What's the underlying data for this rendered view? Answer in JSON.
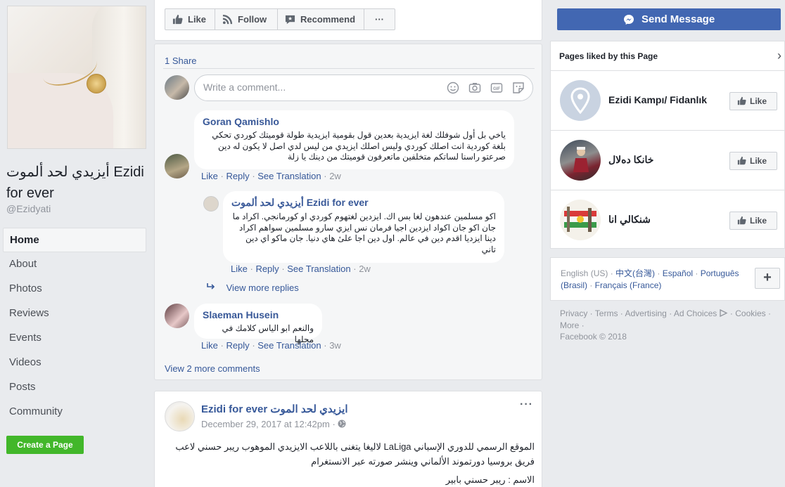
{
  "sidebar": {
    "page_name": "أيزيدي لحد ألموت Ezidi for ever",
    "handle": "@Ezidyati",
    "nav": [
      {
        "label": "Home",
        "active": true
      },
      {
        "label": "About"
      },
      {
        "label": "Photos"
      },
      {
        "label": "Reviews"
      },
      {
        "label": "Events"
      },
      {
        "label": "Videos"
      },
      {
        "label": "Posts"
      },
      {
        "label": "Community"
      }
    ],
    "create_page_label": "Create a Page"
  },
  "actions": {
    "like": "Like",
    "follow": "Follow",
    "recommend": "Recommend",
    "more": "···"
  },
  "post1": {
    "shares": "1 Share",
    "comment_placeholder": "Write a comment...",
    "comments": [
      {
        "author": "Goran Qamishlo",
        "text": "ياخي بل أول شوفلك لغة ايزيدية بعدين قول بقومية ايزيدية طولة قوميتك كوردي تحكي بلغة كوردية انت اصلك كوردي وليس اصلك ايزيدي من ليس لدي اصل لا يكون له دين صرعتو راسنا لساتكم متخلفين ماتعرفون قوميتك من دينك يا زلة",
        "like": "Like",
        "reply": "Reply",
        "translate": "See Translation",
        "time": "2w"
      },
      {
        "author": "أيزيدي لحد ألموت Ezidi for ever",
        "text": "اكو مسلمين عندهون لغا بس اك. ايزدين لغتهوم كوردي او كورمانجي. اكراد ما جان اكو جان اكواد ايزدين اجيا فرمان نس ايزي سارو مسلمين سواهم اكراد دينا ايزديا اقدم دين في عالم. اول دين اجا علىٔ هاي دنيا. جان ماكو اي دين تاني",
        "like": "Like",
        "reply": "Reply",
        "translate": "See Translation",
        "time": "2w"
      },
      {
        "author": "Slaeman Husein",
        "text": "والنعم ابو الياس كلامك في محلها",
        "like": "Like",
        "reply": "Reply",
        "translate": "See Translation",
        "time": "3w"
      }
    ],
    "view_more_replies": "View more replies",
    "view_more_comments": "View 2 more comments"
  },
  "post2": {
    "author": "Ezidi for ever ايزيدي لحد الموت",
    "date": "December 29, 2017 at 12:42pm",
    "text": "الموقع الرسمي للدوري الإسباني LaLiga لاليغا يتغنى باللاعب الايزيدي الموهوب ريبر حسني لاعب فريق بروسيا دورتموند الألماني وينشر صورته عبر الانستغرام",
    "name_line": "الاسم : ريبر حسني بابير"
  },
  "right": {
    "send_message": "Send Message",
    "liked_title": "Pages liked by this Page",
    "liked_pages": [
      {
        "name": "Ezidi Kampı/ Fidanlık",
        "button": "Like"
      },
      {
        "name": "خانكا دەلال",
        "button": "Like"
      },
      {
        "name": "شنكالي انا",
        "button": "Like"
      }
    ],
    "languages": [
      "English (US)",
      "中文(台灣)",
      "Español",
      "Português (Brasil)",
      "Français (France)"
    ],
    "footer_links": [
      "Privacy",
      "Terms",
      "Advertising",
      "Ad Choices",
      "Cookies",
      "More"
    ],
    "copyright": "Facebook © 2018"
  },
  "colors": {
    "facebook_blue": "#4267b2",
    "link_blue": "#365899",
    "create_green": "#42b72a",
    "background": "#e9ebee"
  }
}
